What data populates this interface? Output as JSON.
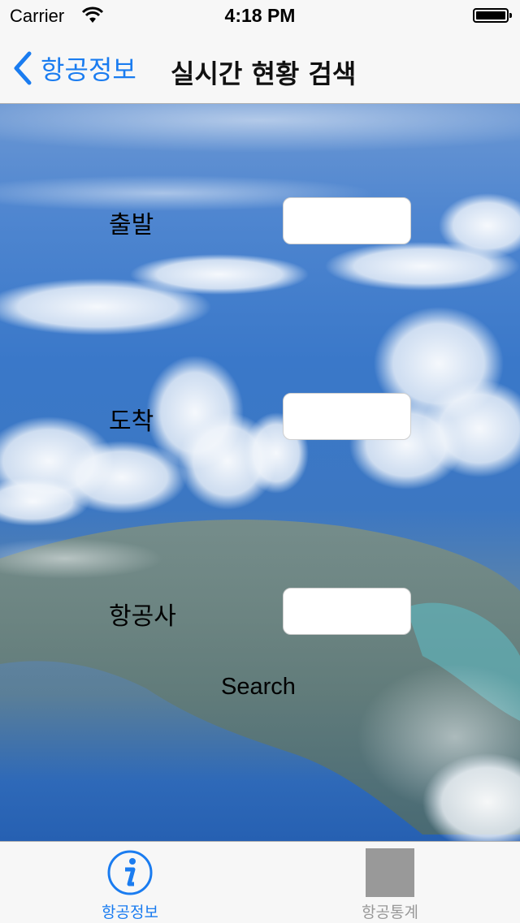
{
  "status_bar": {
    "carrier": "Carrier",
    "time": "4:18 PM"
  },
  "nav": {
    "back_label": "항공정보",
    "title": "실시간 현황 검색"
  },
  "form": {
    "departure_label": "출발",
    "departure_value": "",
    "arrival_label": "도착",
    "arrival_value": "",
    "airline_label": "항공사",
    "airline_value": "",
    "search_label": "Search"
  },
  "tabbar": {
    "items": [
      {
        "label": "항공정보",
        "icon": "info-icon",
        "selected": true
      },
      {
        "label": "항공통계",
        "icon": "placeholder-square-icon",
        "selected": false
      }
    ]
  },
  "colors": {
    "accent": "#1a7cf0",
    "inactive": "#999999"
  }
}
